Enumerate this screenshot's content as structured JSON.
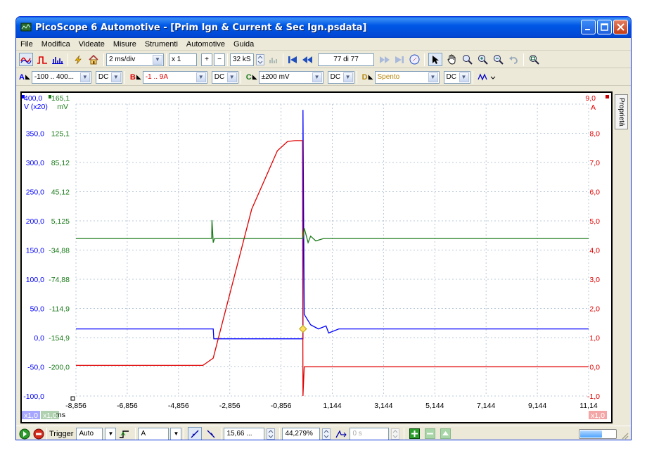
{
  "window": {
    "title": "PicoScope 6 Automotive - [Prim Ign & Current & Sec Ign.psdata]",
    "buttons": [
      "minimize-icon",
      "maximize-icon",
      "close-icon"
    ]
  },
  "menu": [
    "File",
    "Modifica",
    "Videate",
    "Misure",
    "Strumenti",
    "Automotive",
    "Guida"
  ],
  "toolbar": {
    "timebase": "2 ms/div",
    "zoom": "x 1",
    "samples": "32 kS",
    "buffer": "77 di 77"
  },
  "channels": [
    {
      "label": "A",
      "range": "-100 .. 400...",
      "coupling": "DC",
      "color": "#0000ff"
    },
    {
      "label": "B",
      "range": "-1 .. 9A",
      "coupling": "DC",
      "color": "#ff0000"
    },
    {
      "label": "C",
      "range": "±200 mV",
      "coupling": "DC",
      "color": "#008000"
    },
    {
      "label": "D",
      "range": "Spento",
      "coupling": "DC",
      "color": "#b8860b"
    }
  ],
  "side_tab": "Proprietà",
  "colors": {
    "ch_a": "#0000ff",
    "ch_b": "#e00000",
    "ch_c": "#1a7a1a",
    "grid": "#b8c8d8",
    "accent": "#0054e3"
  },
  "status": {
    "trigger_label": "Trigger",
    "trigger_mode": "Auto",
    "trigger_source": "A",
    "threshold": "15,66 ...",
    "pretrigger": "44,279%",
    "delay": "0 s",
    "progress": 0.6
  },
  "chart_data": {
    "type": "line",
    "title": "",
    "xlabel": "ms",
    "xlim": [
      -8.856,
      11.144
    ],
    "x_ticks": [
      "-8,856",
      "-6,856",
      "-4,856",
      "-2,856",
      "-0,856",
      "1,144",
      "3,144",
      "5,144",
      "7,144",
      "9,144",
      "11,14"
    ],
    "left_axis_a": {
      "top_label": "400,0",
      "unit": "V (x20)",
      "ticks": [
        "350,0",
        "300,0",
        "250,0",
        "200,0",
        "150,0",
        "100,0",
        "50,0",
        "0,0",
        "-50,0",
        "-100,0"
      ],
      "ylim": [
        -100,
        400
      ]
    },
    "left_axis_c": {
      "top_label": "165,1",
      "unit": "mV",
      "ticks": [
        "125,1",
        "85,12",
        "45,12",
        "5,125",
        "-34,88",
        "-74,88",
        "-114,9",
        "-154,9",
        "-200,0"
      ],
      "ylim": [
        -200,
        165.1
      ]
    },
    "right_axis_b": {
      "top_label": "9,0",
      "unit": "A",
      "ticks": [
        "8,0",
        "7,0",
        "6,0",
        "5,0",
        "4,0",
        "3,0",
        "2,0",
        "1,0",
        "0,0",
        "-1,0"
      ],
      "ylim": [
        -1,
        9
      ]
    },
    "scale_badges": [
      "x1,0",
      "x1,0",
      "x1,0"
    ],
    "series": [
      {
        "channel": "A",
        "axis": "left_a",
        "color": "#0000ff",
        "x": [
          -8.856,
          -3.5,
          -3.48,
          -0.0,
          0.0,
          0.05,
          0.3,
          0.6,
          0.9,
          1.0,
          1.4,
          11.144
        ],
        "y": [
          15,
          15,
          -2,
          -2,
          390,
          40,
          22,
          15,
          20,
          8,
          15,
          15
        ]
      },
      {
        "channel": "B",
        "axis": "right_b",
        "color": "#e00000",
        "x": [
          -8.856,
          -3.9,
          -3.5,
          -2.0,
          -1.0,
          -0.6,
          -0.3,
          -0.02,
          0.0,
          0.05,
          11.144
        ],
        "y": [
          0.05,
          0.05,
          0.3,
          5.4,
          7.4,
          7.72,
          7.75,
          7.75,
          -1.0,
          0.0,
          0.0
        ]
      },
      {
        "channel": "C",
        "axis": "left_c",
        "color": "#1a7a1a",
        "x": [
          -8.856,
          -3.56,
          -3.55,
          -3.5,
          -3.45,
          0.0,
          0.05,
          0.2,
          0.3,
          0.5,
          0.8,
          11.144
        ],
        "y": [
          -3,
          -3,
          20,
          -8,
          -3,
          -3,
          10,
          -8,
          0,
          -6,
          -3,
          -3
        ]
      }
    ],
    "trigger_marker": {
      "x": 0.0,
      "y": 15
    }
  }
}
